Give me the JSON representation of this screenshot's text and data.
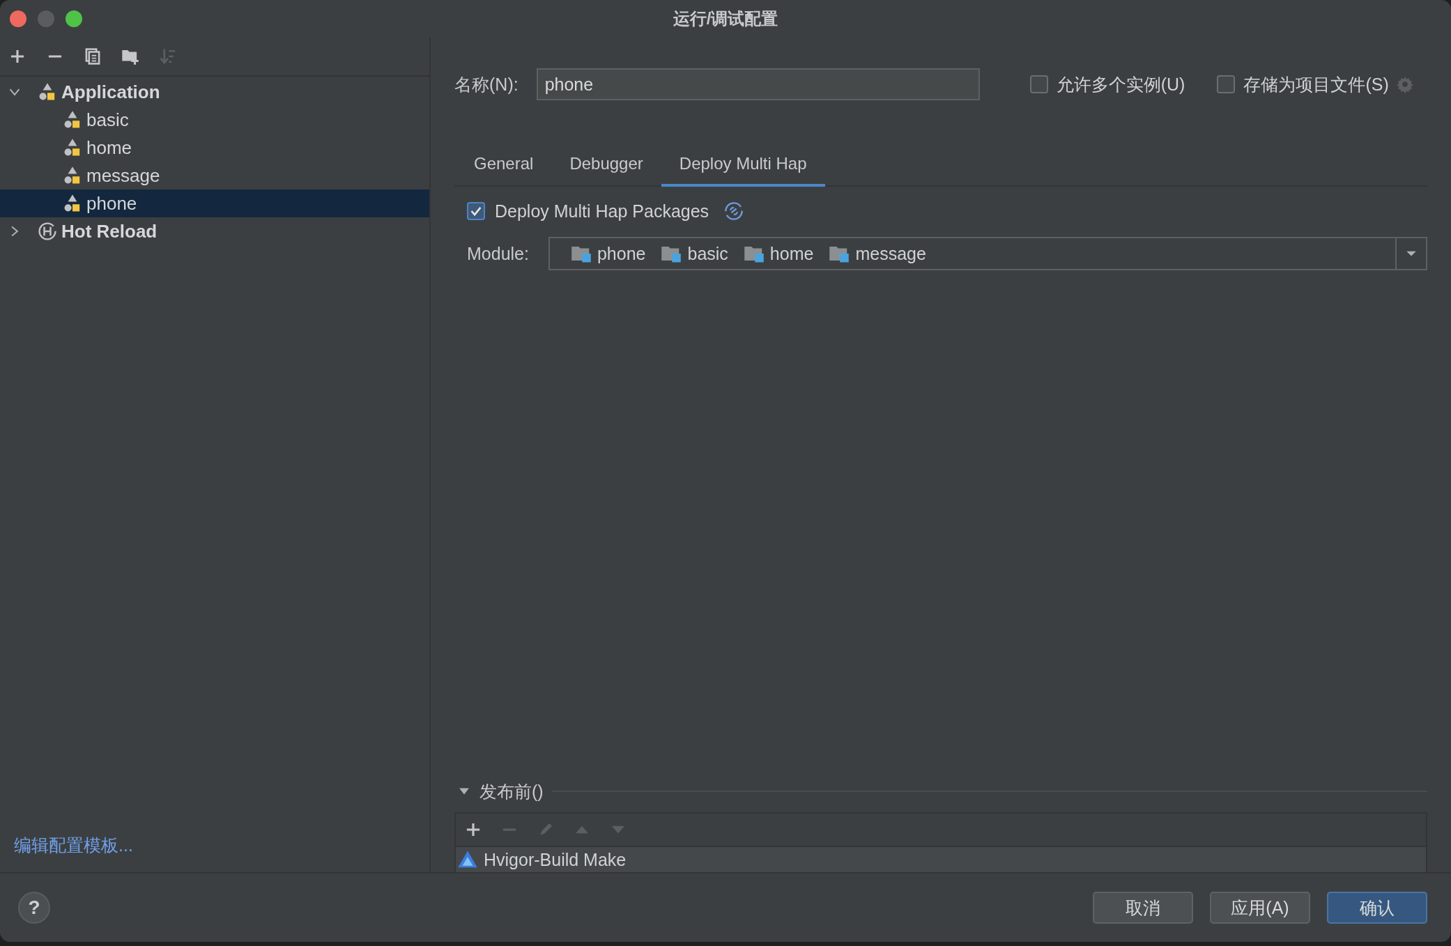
{
  "window": {
    "title": "运行/调试配置"
  },
  "toolbar": [
    {
      "kind": "add",
      "disabled": false
    },
    {
      "kind": "remove",
      "disabled": false
    },
    {
      "kind": "copy",
      "disabled": false
    },
    {
      "kind": "folder",
      "disabled": false
    },
    {
      "kind": "sort",
      "disabled": true
    }
  ],
  "tree": [
    {
      "label": "Application",
      "kind": "application",
      "expanded": true,
      "selected": false,
      "children": [
        {
          "label": "basic",
          "kind": "application",
          "selected": false
        },
        {
          "label": "home",
          "kind": "application",
          "selected": false
        },
        {
          "label": "message",
          "kind": "application",
          "selected": false
        },
        {
          "label": "phone",
          "kind": "application",
          "selected": true
        }
      ]
    },
    {
      "label": "Hot Reload",
      "kind": "hot-reload",
      "expanded": false,
      "selected": false
    }
  ],
  "edit_templates_link": "编辑配置模板...",
  "name": {
    "label": "名称(N):",
    "value": "phone"
  },
  "options": [
    {
      "label": "允许多个实例(U)",
      "checked": false
    },
    {
      "label": "存储为项目文件(S)",
      "checked": false
    }
  ],
  "tabs": [
    {
      "label": "General",
      "selected": false
    },
    {
      "label": "Debugger",
      "selected": false
    },
    {
      "label": "Deploy Multi Hap",
      "selected": true
    }
  ],
  "deploy": {
    "label": "Deploy Multi Hap Packages",
    "checked": true
  },
  "module": {
    "label": "Module:",
    "values": [
      "phone",
      "basic",
      "home",
      "message"
    ]
  },
  "before_launch": {
    "title": "发布前()",
    "expanded": true,
    "toolbar": [
      {
        "kind": "add",
        "disabled": false
      },
      {
        "kind": "remove",
        "disabled": true
      },
      {
        "kind": "edit",
        "disabled": true
      },
      {
        "kind": "up",
        "disabled": true
      },
      {
        "kind": "down",
        "disabled": true
      }
    ],
    "tasks": [
      "Hvigor-Build Make"
    ]
  },
  "help": "?",
  "buttons": [
    {
      "label": "取消",
      "kind": "default"
    },
    {
      "label": "应用(A)",
      "kind": "default"
    },
    {
      "label": "确认",
      "kind": "primary"
    }
  ]
}
